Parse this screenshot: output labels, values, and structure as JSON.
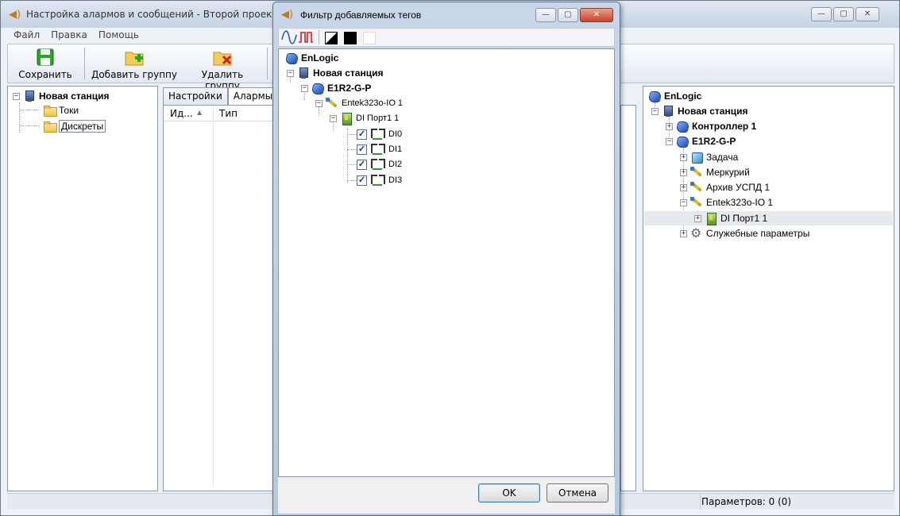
{
  "main_window": {
    "title": "Настройка алармов и сообщений - Второй проект [a",
    "menu": [
      "Файл",
      "Правка",
      "Помощь"
    ],
    "toolbar": {
      "save": "Сохранить",
      "add_group": "Добавить группу",
      "delete_group": "Удалить группу"
    },
    "window_buttons": {
      "minimize": "—",
      "maximize": "▢",
      "close": "✕"
    }
  },
  "left_tree": {
    "root": "Новая станция",
    "groups": [
      "Токи",
      "Дискреты"
    ]
  },
  "middle": {
    "tabs": [
      "Настройки",
      "Алармы"
    ],
    "columns": [
      "Ид...",
      "Тип"
    ],
    "sort_arrow": "▲"
  },
  "right_tree": {
    "root": "EnLogic",
    "station": "Новая станция",
    "controller": "Контроллер 1",
    "device": "E1R2-G-P",
    "children": [
      "Задача",
      "Меркурий",
      "Архив УСПД 1",
      "Entek323o-IO 1"
    ],
    "port": "DI Порт1 1",
    "service": "Служебные параметры"
  },
  "status": {
    "params": "Параметров: 0 (0)"
  },
  "dialog": {
    "title": "Фильтр добавляемых тегов",
    "tree": {
      "root": "EnLogic",
      "station": "Новая станция",
      "device": "E1R2-G-P",
      "module": "Entek323o-IO 1",
      "port": "DI Порт1 1",
      "tags": [
        "DI0",
        "DI1",
        "DI2",
        "DI3"
      ]
    },
    "ok": "OK",
    "cancel": "Отмена",
    "check_mark": "✓"
  }
}
